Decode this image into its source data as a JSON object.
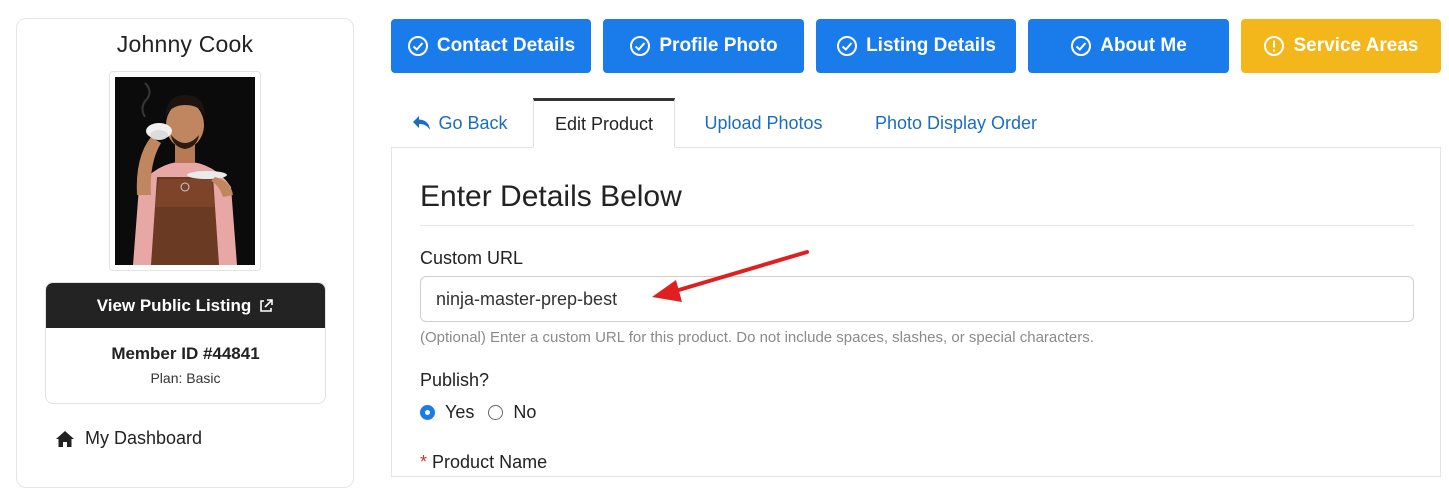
{
  "sidebar": {
    "member_name": "Johnny Cook",
    "view_listing_label": "View Public Listing",
    "member_id": "Member ID #44841",
    "plan": "Plan: Basic",
    "nav": [
      {
        "label": "My Dashboard",
        "icon": "home-icon"
      }
    ]
  },
  "steps": [
    {
      "label": "Contact Details",
      "color": "#1a7bea",
      "icon": "check-circle-icon"
    },
    {
      "label": "Profile Photo",
      "color": "#1a7bea",
      "icon": "check-circle-icon"
    },
    {
      "label": "Listing Details",
      "color": "#1a7bea",
      "icon": "check-circle-icon"
    },
    {
      "label": "About Me",
      "color": "#1a7bea",
      "icon": "check-circle-icon"
    },
    {
      "label": "Service Areas",
      "color": "#f4b71b",
      "icon": "exclamation-circle-icon"
    }
  ],
  "tabs": [
    {
      "label": "Go Back",
      "icon": "reply-arrow-icon",
      "active": false
    },
    {
      "label": "Edit Product",
      "active": true
    },
    {
      "label": "Upload Photos",
      "active": false
    },
    {
      "label": "Photo Display Order",
      "active": false
    }
  ],
  "form": {
    "title": "Enter Details Below",
    "custom_url_label": "Custom URL",
    "custom_url_value": "ninja-master-prep-best",
    "custom_url_help": "(Optional) Enter a custom URL for this product. Do not include spaces, slashes, or special characters.",
    "publish_label": "Publish?",
    "publish_options": [
      "Yes",
      "No"
    ],
    "publish_selected": "Yes",
    "product_name_required_mark": "*",
    "product_name_label": "Product Name"
  },
  "annotation": {
    "arrow_color": "#e02020"
  }
}
